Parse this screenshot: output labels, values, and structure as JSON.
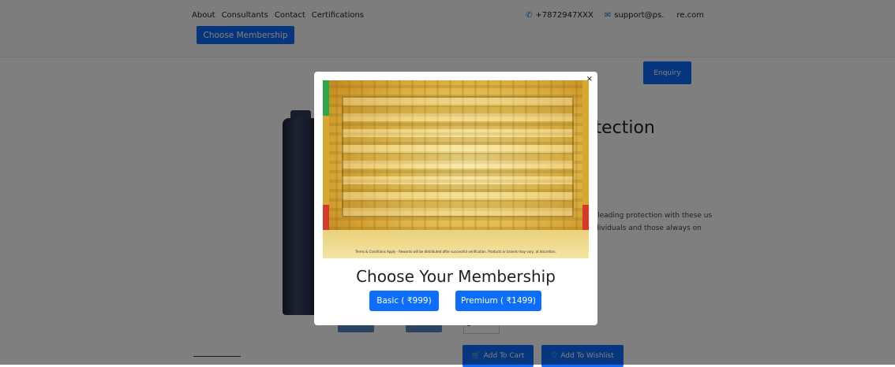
{
  "nav": {
    "links": [
      "About",
      "Consultants",
      "Contact",
      "Certifications"
    ],
    "choose_membership": "Choose Membership"
  },
  "contact": {
    "phone": "+7872947XXX",
    "email": "support@ps.        re.com"
  },
  "page": {
    "enquiry": "Enquiry",
    "heading_fragment": "otection",
    "description": "ry-leading protection with these us individuals and those always on",
    "quantity": "1",
    "add_to_cart": "Add To Cart",
    "add_to_wishlist": "Add To Wishlist"
  },
  "modal": {
    "close": "×",
    "banner_terms": "Terms & Conditions Apply · Rewards will be distributed after successful verification. Products or brands may vary, at discretion.",
    "title": "Choose Your Membership",
    "basic": "Basic ( ₹999)",
    "premium": "Premium ( ₹1499)"
  },
  "colors": {
    "primary": "#0d6efd",
    "overlay": "rgba(0,0,0,0.5)"
  }
}
